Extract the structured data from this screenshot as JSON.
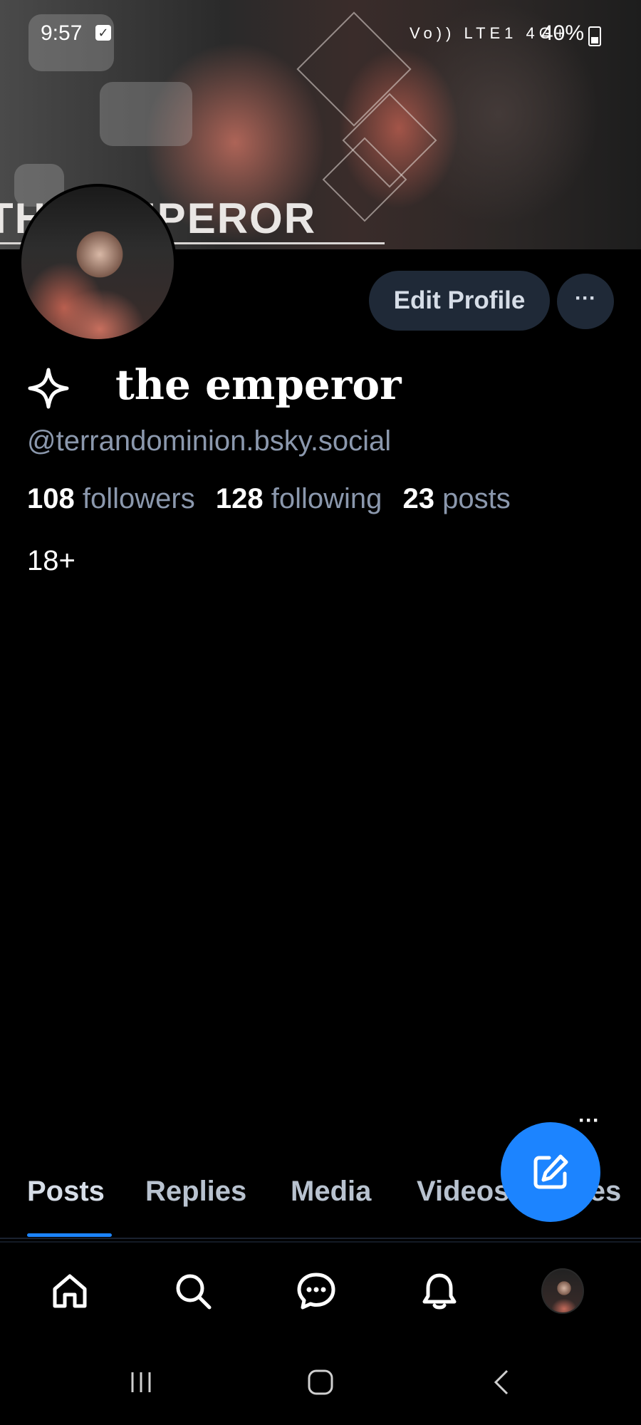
{
  "status_bar": {
    "time": "9:57",
    "network_icons": "Vo)) LTE1 4G+",
    "battery": "40%"
  },
  "banner": {
    "text": "THE EMPEROR"
  },
  "profile": {
    "display_name": "the emperor",
    "handle": "@terrandominion.bsky.social",
    "followers_count": "108",
    "followers_label": "followers",
    "following_count": "128",
    "following_label": "following",
    "posts_count": "23",
    "posts_label": "posts",
    "label": "18+"
  },
  "actions": {
    "edit_profile": "Edit Profile",
    "more": "···"
  },
  "tabs": [
    {
      "label": "Posts",
      "active": true
    },
    {
      "label": "Replies"
    },
    {
      "label": "Media"
    },
    {
      "label": "Videos"
    },
    {
      "label": "Likes"
    }
  ],
  "floating": {
    "dots": "···"
  },
  "bottom_nav": [
    "home-icon",
    "search-icon",
    "chat-icon",
    "bell-icon",
    "profile-avatar"
  ],
  "colors": {
    "accent": "#1c84ff",
    "secondary_text": "#8b98ad",
    "button_bg": "#1f2937"
  }
}
